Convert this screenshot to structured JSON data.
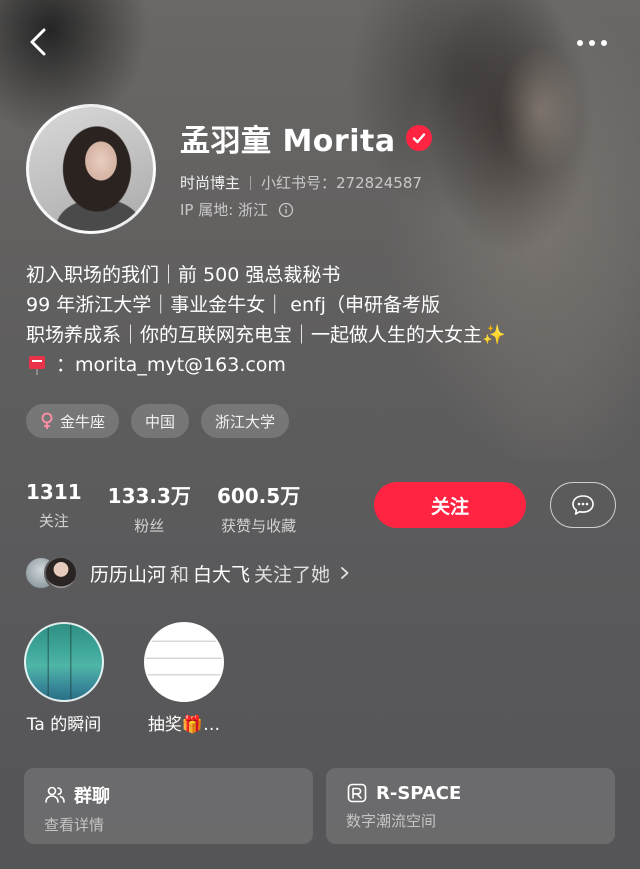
{
  "profile": {
    "name": "孟羽童 Morita",
    "category": "时尚博主",
    "redbook_id": "小红书号：272824587",
    "ip_location": "IP 属地: 浙江"
  },
  "bio": {
    "line1": "初入职场的我们｜前 500 强总裁秘书",
    "line2": "99 年浙江大学｜事业金牛女｜ enfj（申研备考版",
    "line3": "职场养成系｜你的互联网充电宝｜一起做人生的大女主✨",
    "line4": "：morita_myt@163.com"
  },
  "tags": [
    {
      "label": "金牛座",
      "icon": "female-icon"
    },
    {
      "label": "中国"
    },
    {
      "label": "浙江大学"
    }
  ],
  "stats": [
    {
      "value": "1311",
      "label": "关注"
    },
    {
      "value": "133.3万",
      "label": "粉丝"
    },
    {
      "value": "600.5万",
      "label": "获赞与收藏"
    }
  ],
  "actions": {
    "follow_label": "关注"
  },
  "mutual": {
    "name1": "历历山河",
    "conjunction": "和",
    "name2": "白大飞",
    "suffix": "关注了她"
  },
  "highlights": [
    {
      "label": "Ta 的瞬间"
    },
    {
      "label": "抽奖🎁…"
    }
  ],
  "cards": [
    {
      "title": "群聊",
      "subtitle": "查看详情",
      "icon": "group-chat-icon"
    },
    {
      "title": "R-SPACE",
      "subtitle": "数字潮流空间",
      "icon": "r-space-icon"
    }
  ],
  "colors": {
    "accent": "#ff2442",
    "background": "#5c5c5e"
  }
}
